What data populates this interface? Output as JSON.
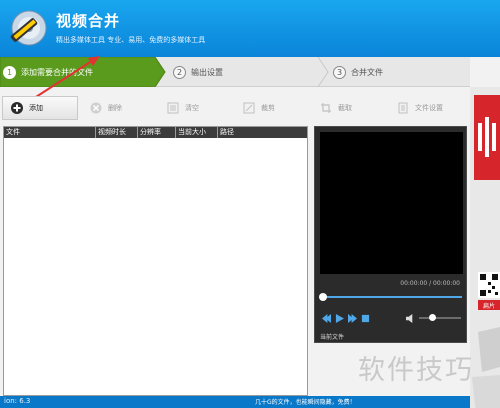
{
  "app": {
    "title": "视频合并",
    "subtitle": "精出多媒体工具  专业、易用、免费的多媒体工具"
  },
  "steps": [
    {
      "num": "1",
      "label": "添加需要合并的文件",
      "active": true
    },
    {
      "num": "2",
      "label": "输出设置",
      "active": false
    },
    {
      "num": "3",
      "label": "合并文件",
      "active": false
    }
  ],
  "toolbar": {
    "add": "添加",
    "delete": "删除",
    "clear": "清空",
    "crop": "裁剪",
    "trim": "截取",
    "file_settings": "文件设置"
  },
  "file_list": {
    "columns": [
      "文件",
      "视频时长",
      "分辨率",
      "当前大小",
      "路径"
    ]
  },
  "preview": {
    "timecode": "00:00:00 / 00:00:00",
    "current_file_label": "当前文件"
  },
  "ad": {
    "text": "扁片"
  },
  "status": {
    "version": "ion: 6.3",
    "message": "几十G的文件，也能瞬间隐藏，免费！"
  },
  "watermark": "软件技巧",
  "colors": {
    "header": "#0a84d8",
    "step_active": "#5a9b1e",
    "statusbar": "#0a78c8",
    "ad_red": "#d6262b"
  }
}
